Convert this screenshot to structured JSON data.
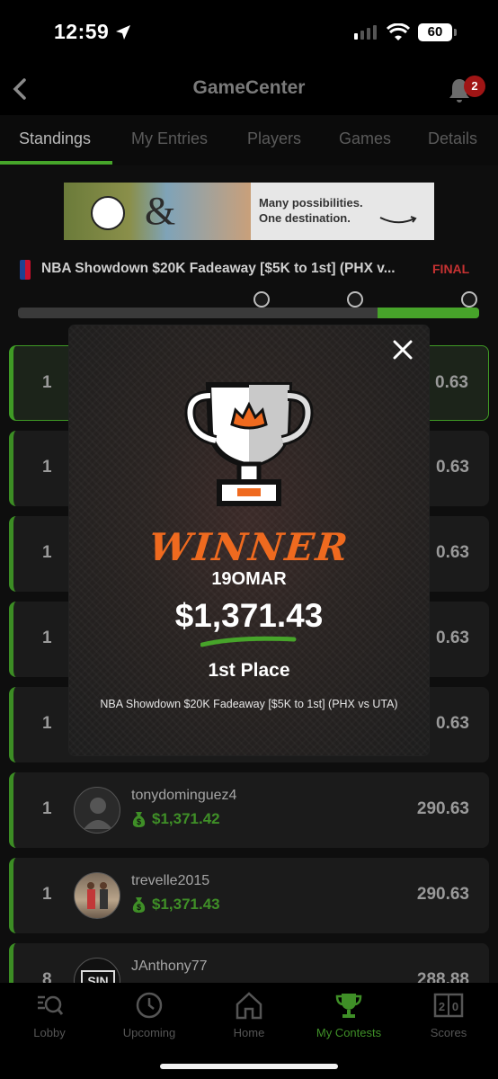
{
  "status_bar": {
    "time": "12:59",
    "battery": "60"
  },
  "header": {
    "title": "GameCenter",
    "notification_count": "2"
  },
  "tabs": [
    {
      "label": "Standings",
      "active": true
    },
    {
      "label": "My Entries",
      "active": false
    },
    {
      "label": "Players",
      "active": false
    },
    {
      "label": "Games",
      "active": false
    },
    {
      "label": "Details",
      "active": false
    }
  ],
  "ad": {
    "line1": "Many possibilities.",
    "line2": "One destination."
  },
  "contest": {
    "name": "NBA Showdown $20K Fadeaway [$5K to 1st] (PHX v...",
    "status": "FINAL",
    "progress": 0.22
  },
  "standings": [
    {
      "rank": "1",
      "points": "0.63"
    },
    {
      "rank": "1",
      "points": "0.63"
    },
    {
      "rank": "1",
      "points": "0.63"
    },
    {
      "rank": "1",
      "points": "0.63"
    },
    {
      "rank": "1",
      "points": "0.63"
    },
    {
      "rank": "1",
      "username": "tonydominguez4",
      "winnings": "$1,371.42",
      "points": "290.63"
    },
    {
      "rank": "1",
      "username": "trevelle2015",
      "winnings": "$1,371.43",
      "points": "290.63"
    },
    {
      "rank": "8",
      "username": "JAnthony77",
      "points": "288.88"
    }
  ],
  "modal": {
    "heading": "WINNER",
    "username": "19OMAR",
    "amount": "$1,371.43",
    "place": "1st Place",
    "contest": "NBA Showdown $20K Fadeaway [$5K to 1st] (PHX vs UTA)"
  },
  "bottom_nav": [
    {
      "label": "Lobby",
      "icon": "lobby-search-icon",
      "active": false
    },
    {
      "label": "Upcoming",
      "icon": "clock-icon",
      "active": false
    },
    {
      "label": "Home",
      "icon": "home-icon",
      "active": false
    },
    {
      "label": "My Contests",
      "icon": "trophy-icon",
      "active": true
    },
    {
      "label": "Scores",
      "icon": "scoreboard-icon",
      "active": false
    }
  ],
  "colors": {
    "accent_green": "#47a42a",
    "final_red": "#c63232",
    "winner_orange": "#ef6a1f"
  }
}
